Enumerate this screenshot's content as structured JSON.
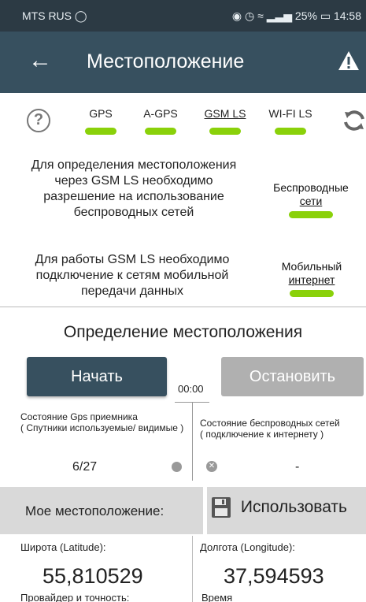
{
  "status_bar": {
    "carrier": "MTS RUS",
    "battery": "25%",
    "time": "14:58"
  },
  "app_bar": {
    "title": "Местоположение"
  },
  "providers": [
    {
      "label": "GPS",
      "active": true
    },
    {
      "label": "A-GPS",
      "active": true
    },
    {
      "label": "GSM LS",
      "active": true
    },
    {
      "label": "WI-FI LS",
      "active": true
    }
  ],
  "permissions": {
    "gsm_text": "Для определения местоположения через GSM LS необходимо разрешение на использование беспроводных сетей",
    "wireless_label_1": "Беспроводные",
    "wireless_label_2": "сети",
    "mobile_text": "Для работы GSM LS необходимо подключение к сетям мобильной передачи данных",
    "mobile_label_1": "Мобильный",
    "mobile_label_2": "интернет"
  },
  "detection": {
    "title": "Определение местоположения",
    "start_label": "Начать",
    "stop_label": "Остановить",
    "timer": "00:00"
  },
  "gps_receiver": {
    "title": "Состояние Gps приемника",
    "subtitle": "( Спутники используемые/ видимые )",
    "value": "6/27"
  },
  "wireless_state": {
    "title": "Состояние беспроводных сетей",
    "subtitle": "( подключение к интернету )",
    "value": "-"
  },
  "my_location": {
    "label": "Мое местоположение:",
    "use_label": "Использовать"
  },
  "coordinates": {
    "lat_label": "Широта (Latitude):",
    "lat_value": "55,810529",
    "lon_label": "Долгота (Longitude):",
    "lon_value": "37,594593",
    "provider_label": "Провайдер и точность:",
    "time_label": "Время"
  },
  "colors": {
    "app_bar": "#37505f",
    "indicator_green": "#8ad10a",
    "disabled_button": "#b0b0b0"
  }
}
